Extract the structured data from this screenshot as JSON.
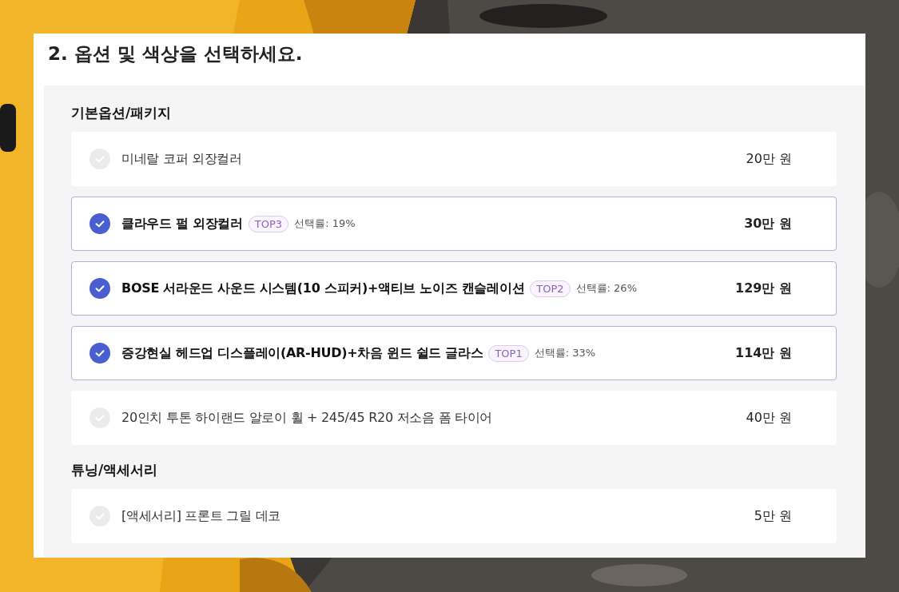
{
  "title": "2. 옵션 및 색상을 선택하세요.",
  "sections": [
    {
      "heading": "기본옵션/패키지",
      "options": [
        {
          "name": "미네랄 코퍼 외장컬러",
          "price": "20만 원",
          "selected": false
        },
        {
          "name": "클라우드 펄 외장컬러",
          "badge": "TOP3",
          "rate": "선택률: 19%",
          "price": "30만 원",
          "selected": true
        },
        {
          "name": "BOSE 서라운드 사운드 시스템(10 스피커)+액티브 노이즈 캔슬레이션",
          "badge": "TOP2",
          "rate": "선택률: 26%",
          "price": "129만 원",
          "selected": true
        },
        {
          "name": "증강현실 헤드업 디스플레이(AR-HUD)+차음 윈드 쉴드 글라스",
          "badge": "TOP1",
          "rate": "선택률: 33%",
          "price": "114만 원",
          "selected": true
        },
        {
          "name": "20인치 투톤 하이랜드 알로이 휠 + 245/45 R20 저소음 폼 타이어",
          "price": "40만 원",
          "selected": false
        }
      ]
    },
    {
      "heading": "튜닝/액세서리",
      "options": [
        {
          "name": "[액세서리] 프론트 그릴 데코",
          "price": "5만 원",
          "selected": false
        }
      ]
    }
  ]
}
